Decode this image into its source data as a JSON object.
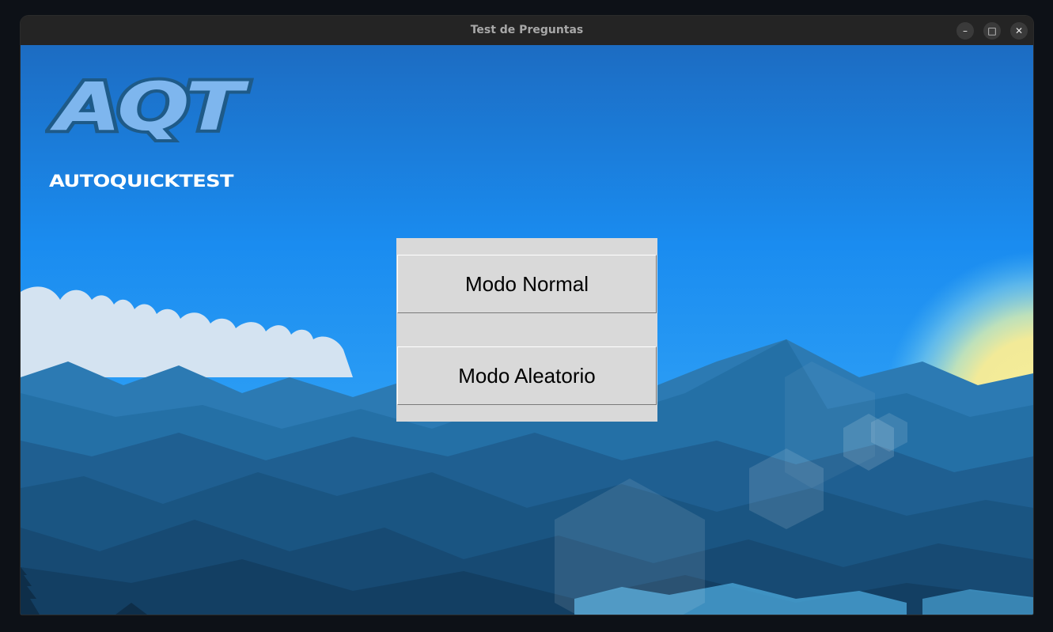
{
  "window": {
    "title": "Test de Preguntas",
    "controls": {
      "minimize": "–",
      "maximize": "□",
      "close": "✕"
    }
  },
  "logo": {
    "letters": "AQT",
    "subtitle": "AUTOQUICKTEST"
  },
  "menu": {
    "normal_label": "Modo Normal",
    "random_label": "Modo Aleatorio"
  },
  "colors": {
    "panel": "#d9d9d9",
    "sky_top": "#1f6fc4",
    "sky_mid": "#1a8cf0",
    "logo_fill": "#7eb6ee",
    "logo_stroke": "#1e5a88"
  }
}
